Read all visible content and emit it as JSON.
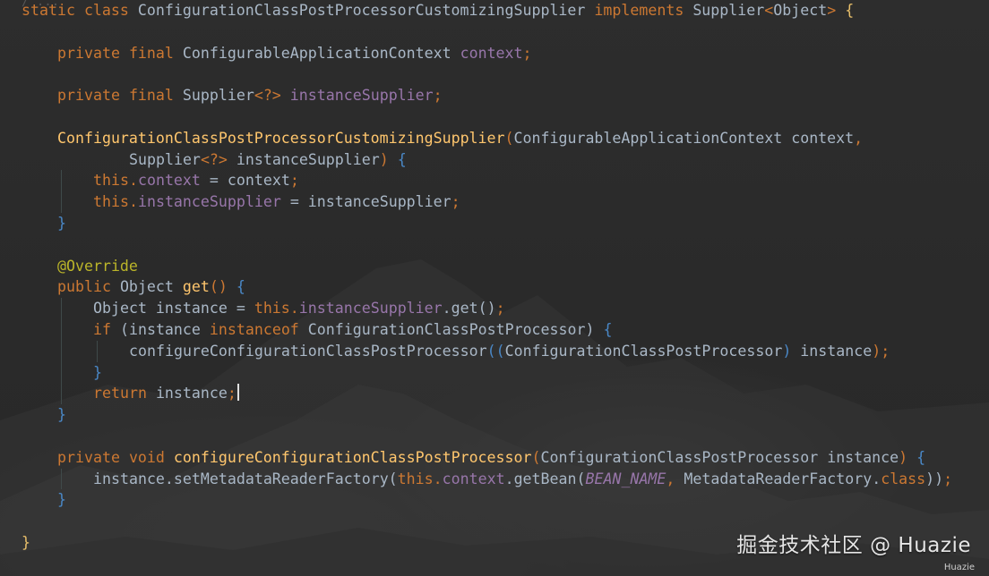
{
  "editor": {
    "top_fragment": "/  ...",
    "lines": [
      [
        {
          "t": "static ",
          "c": "kw"
        },
        {
          "t": "class ",
          "c": "kw"
        },
        {
          "t": "ConfigurationClassPostProcessorCustomizingSupplier ",
          "c": "id"
        },
        {
          "t": "implements ",
          "c": "kw"
        },
        {
          "t": "Supplier",
          "c": "id"
        },
        {
          "t": "<",
          "c": "pn"
        },
        {
          "t": "Object",
          "c": "id"
        },
        {
          "t": "> ",
          "c": "pn"
        },
        {
          "t": "{",
          "c": "br-o"
        }
      ],
      [],
      [
        {
          "t": "private ",
          "c": "kw"
        },
        {
          "t": "final ",
          "c": "kw"
        },
        {
          "t": "ConfigurableApplicationContext ",
          "c": "id"
        },
        {
          "t": "context",
          "c": "fld"
        },
        {
          "t": ";",
          "c": "pn"
        }
      ],
      [],
      [
        {
          "t": "private ",
          "c": "kw"
        },
        {
          "t": "final ",
          "c": "kw"
        },
        {
          "t": "Supplier",
          "c": "id"
        },
        {
          "t": "<?> ",
          "c": "pn"
        },
        {
          "t": "instanceSupplier",
          "c": "fld"
        },
        {
          "t": ";",
          "c": "pn"
        }
      ],
      [],
      [
        {
          "t": "ConfigurationClassPostProcessorCustomizingSupplier",
          "c": "fn"
        },
        {
          "t": "(",
          "c": "pn"
        },
        {
          "t": "ConfigurableApplicationContext context",
          "c": "id"
        },
        {
          "t": ",",
          "c": "pn"
        }
      ],
      [
        {
          "t": "Supplier",
          "c": "id"
        },
        {
          "t": "<?> ",
          "c": "pn"
        },
        {
          "t": "instanceSupplier",
          "c": "id"
        },
        {
          "t": ") ",
          "c": "pn"
        },
        {
          "t": "{",
          "c": "br-b"
        }
      ],
      [
        {
          "t": "this",
          "c": "kw"
        },
        {
          "t": ".",
          "c": "pn"
        },
        {
          "t": "context ",
          "c": "fld"
        },
        {
          "t": "= context",
          "c": "id"
        },
        {
          "t": ";",
          "c": "pn"
        }
      ],
      [
        {
          "t": "this",
          "c": "kw"
        },
        {
          "t": ".",
          "c": "pn"
        },
        {
          "t": "instanceSupplier ",
          "c": "fld"
        },
        {
          "t": "= instanceSupplier",
          "c": "id"
        },
        {
          "t": ";",
          "c": "pn"
        }
      ],
      [
        {
          "t": "}",
          "c": "br-b"
        }
      ],
      [],
      [
        {
          "t": "@Override",
          "c": "ann"
        }
      ],
      [
        {
          "t": "public ",
          "c": "kw"
        },
        {
          "t": "Object ",
          "c": "id"
        },
        {
          "t": "get",
          "c": "fn"
        },
        {
          "t": "() ",
          "c": "pn"
        },
        {
          "t": "{",
          "c": "br-b"
        }
      ],
      [
        {
          "t": "Object instance = ",
          "c": "id"
        },
        {
          "t": "this",
          "c": "kw"
        },
        {
          "t": ".",
          "c": "pn"
        },
        {
          "t": "instanceSupplier",
          "c": "fld"
        },
        {
          "t": ".get()",
          "c": "id"
        },
        {
          "t": ";",
          "c": "pn"
        }
      ],
      [
        {
          "t": "if ",
          "c": "kw"
        },
        {
          "t": "(instance ",
          "c": "id"
        },
        {
          "t": "instanceof ",
          "c": "kw"
        },
        {
          "t": "ConfigurationClassPostProcessor) ",
          "c": "id"
        },
        {
          "t": "{",
          "c": "br-b"
        }
      ],
      [
        {
          "t": "configureConfigurationClassPostProcessor",
          "c": "id"
        },
        {
          "t": "((",
          "c": "br-b"
        },
        {
          "t": "ConfigurationClassPostProcessor",
          "c": "id"
        },
        {
          "t": ") ",
          "c": "br-b"
        },
        {
          "t": "instance",
          "c": "id"
        },
        {
          "t": ")",
          "c": "pn"
        },
        {
          "t": ";",
          "c": "pn"
        }
      ],
      [
        {
          "t": "}",
          "c": "br-b"
        }
      ],
      [
        {
          "t": "return ",
          "c": "kw"
        },
        {
          "t": "instance",
          "c": "id"
        },
        {
          "t": ";",
          "c": "pn"
        },
        {
          "t": "",
          "c": "caret"
        }
      ],
      [
        {
          "t": "}",
          "c": "br-b"
        }
      ],
      [],
      [
        {
          "t": "private ",
          "c": "kw"
        },
        {
          "t": "void ",
          "c": "kw"
        },
        {
          "t": "configureConfigurationClassPostProcessor",
          "c": "fn"
        },
        {
          "t": "(",
          "c": "pn"
        },
        {
          "t": "ConfigurationClassPostProcessor instance",
          "c": "id"
        },
        {
          "t": ") ",
          "c": "pn"
        },
        {
          "t": "{",
          "c": "br-b"
        }
      ],
      [
        {
          "t": "instance.setMetadataReaderFactory(",
          "c": "id"
        },
        {
          "t": "this",
          "c": "kw"
        },
        {
          "t": ".",
          "c": "pn"
        },
        {
          "t": "context",
          "c": "fld"
        },
        {
          "t": ".getBean(",
          "c": "id"
        },
        {
          "t": "BEAN_NAME",
          "c": "cst"
        },
        {
          "t": ", ",
          "c": "pn"
        },
        {
          "t": "MetadataReaderFactory.",
          "c": "id"
        },
        {
          "t": "class",
          "c": "kw"
        },
        {
          "t": "))",
          "c": "id"
        },
        {
          "t": ";",
          "c": "pn"
        }
      ],
      [
        {
          "t": "}",
          "c": "br-b"
        }
      ],
      [],
      [
        {
          "t": "}",
          "c": "br-o"
        }
      ]
    ]
  },
  "watermark": {
    "main": "掘金技术社区 @ Huazie",
    "sub": "Huazie"
  },
  "colors": {
    "background": "#2b2b2b",
    "keyword": "#cc7832",
    "field": "#9876aa",
    "method": "#ffc66d",
    "annotation": "#bbb529",
    "identifier": "#a9b7c6"
  }
}
